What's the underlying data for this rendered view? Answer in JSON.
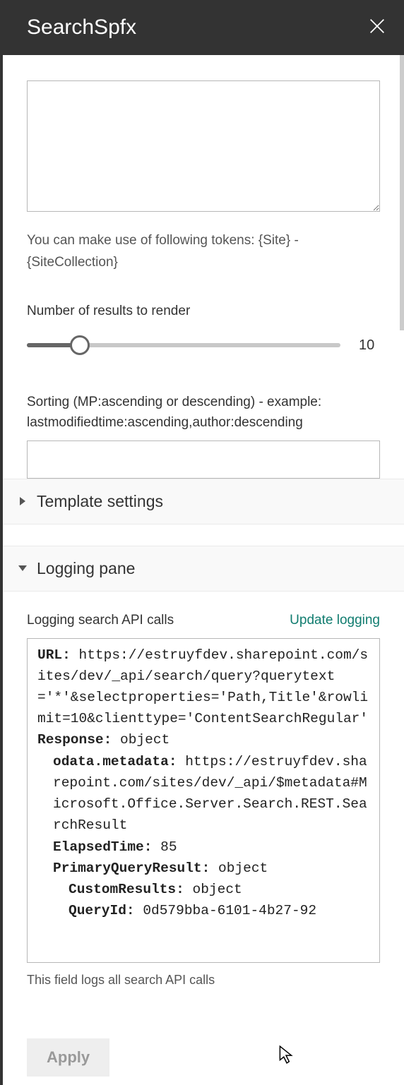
{
  "header": {
    "title": "SearchSpfx"
  },
  "queryArea": {
    "value": "",
    "helpText": "You can make use of following tokens: {Site} - {SiteCollection}"
  },
  "results": {
    "label": "Number of results to render",
    "value": "10"
  },
  "sorting": {
    "label": "Sorting (MP:ascending or descending) - example: lastmodifiedtime:ascending,author:descending",
    "value": ""
  },
  "sections": {
    "template": {
      "title": "Template settings"
    },
    "logging": {
      "title": "Logging pane"
    }
  },
  "logging": {
    "label": "Logging search API calls",
    "updateLink": "Update logging",
    "helpText": "This field logs all search API calls",
    "log": {
      "url_label": "URL:",
      "url_value": "https://estruyfdev.sharepoint.com/sites/dev/_api/search/query?querytext='*'&selectproperties='Path,Title'&rowlimit=10&clienttype='ContentSearchRegular'",
      "response_label": "Response:",
      "response_value": "object",
      "odata_label": "odata.metadata:",
      "odata_value": "https://estruyfdev.sharepoint.com/sites/dev/_api/$metadata#Microsoft.Office.Server.Search.REST.SearchResult",
      "elapsed_label": "ElapsedTime:",
      "elapsed_value": "85",
      "pqr_label": "PrimaryQueryResult:",
      "pqr_value": "object",
      "custom_label": "CustomResults:",
      "custom_value": "object",
      "qid_label": "QueryId:",
      "qid_value": "0d579bba-6101-4b27-92"
    }
  },
  "footer": {
    "applyLabel": "Apply"
  }
}
